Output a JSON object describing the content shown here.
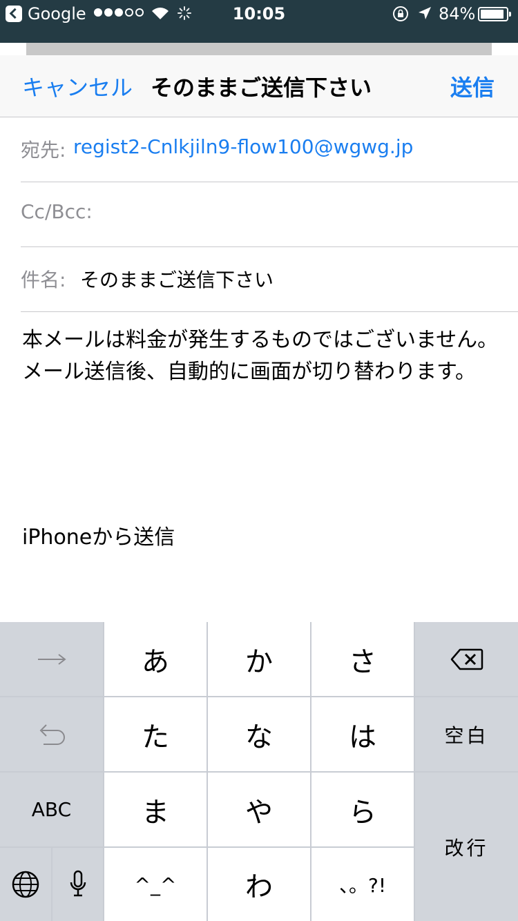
{
  "status_bar": {
    "back_app": "Google",
    "time": "10:05",
    "battery_percent": "84%",
    "signal_bars_filled": 3,
    "signal_bars_total": 5
  },
  "nav": {
    "cancel_label": "キャンセル",
    "title": "そのままご送信下さい",
    "send_label": "送信"
  },
  "fields": {
    "to_label": "宛先:",
    "to_value": "regist2-Cnlkjiln9-flow100@wgwg.jp",
    "cc_label": "Cc/Bcc:",
    "cc_value": "",
    "subject_label": "件名:",
    "subject_value": "そのままご送信下さい"
  },
  "body": {
    "line1": "本メールは料金が発生するものではございません。",
    "line2": "メール送信後、自動的に画面が切り替わります。",
    "signature": "iPhoneから送信"
  },
  "keyboard": {
    "keys": {
      "a": "あ",
      "ka": "か",
      "sa": "さ",
      "ta": "た",
      "na": "な",
      "ha": "は",
      "ma": "ま",
      "ya": "や",
      "ra": "ら",
      "emoticon": "^_^",
      "wa": "わ",
      "punct": "、。?!",
      "space": "空白",
      "return": "改行",
      "abc": "ABC"
    }
  },
  "colors": {
    "accent": "#1a7ef0",
    "status_bar_bg": "#243b44",
    "keyboard_dark_key": "#d1d5db",
    "keyboard_light_key": "#ffffff"
  },
  "icons": [
    "back-arrow-icon",
    "wifi-icon",
    "activity-spinner-icon",
    "orientation-lock-icon",
    "location-arrow-icon",
    "battery-icon",
    "next-arrow-icon",
    "undo-icon",
    "globe-icon",
    "microphone-icon",
    "delete-icon"
  ]
}
